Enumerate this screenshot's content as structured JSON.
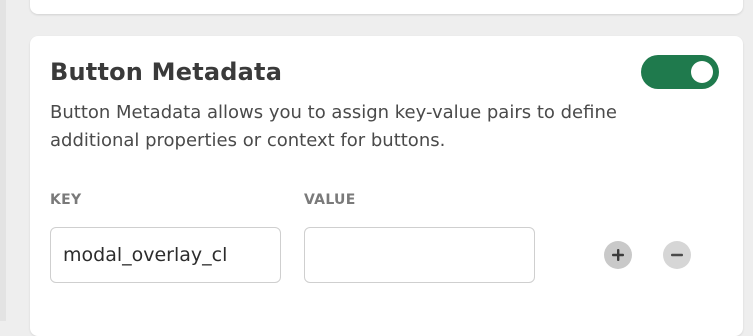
{
  "metadata_panel": {
    "title": "Button Metadata",
    "enabled": true,
    "description": "Button Metadata allows you to assign key-value pairs to define additional properties or context for buttons.",
    "columns": {
      "key_label": "KEY",
      "value_label": "VALUE"
    },
    "rows": [
      {
        "key": "modal_overlay_cl",
        "value": ""
      }
    ],
    "actions": {
      "add_icon": "plus-icon",
      "remove_icon": "minus-icon"
    },
    "colors": {
      "toggle_on": "#1f7a4d",
      "card_bg": "#ffffff",
      "page_bg": "#eeeeee"
    }
  }
}
